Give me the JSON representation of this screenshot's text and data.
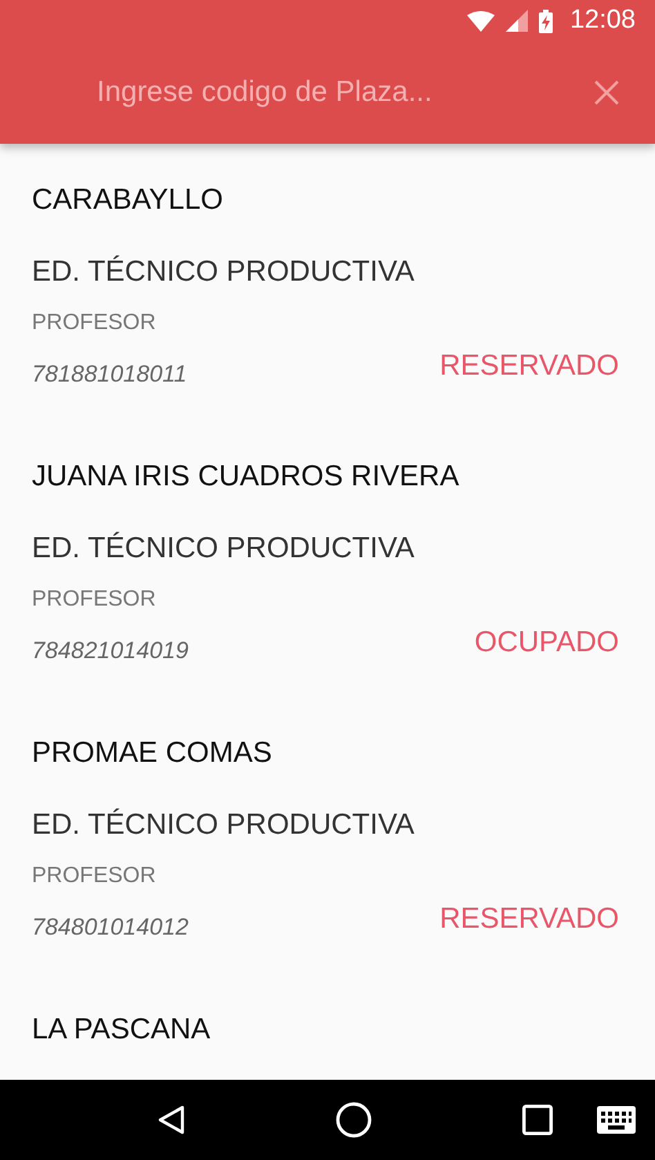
{
  "status_bar": {
    "time": "12:08"
  },
  "search": {
    "placeholder": "Ingrese codigo de Plaza..."
  },
  "items": [
    {
      "name": "CARABAYLLO",
      "type": "ED. TÉCNICO PRODUCTIVA",
      "role": "PROFESOR",
      "code": "781881018011",
      "status": "RESERVADO"
    },
    {
      "name": "JUANA IRIS CUADROS RIVERA",
      "type": "ED. TÉCNICO PRODUCTIVA",
      "role": "PROFESOR",
      "code": "784821014019",
      "status": "OCUPADO"
    },
    {
      "name": "PROMAE COMAS",
      "type": "ED. TÉCNICO PRODUCTIVA",
      "role": "PROFESOR",
      "code": "784801014012",
      "status": "RESERVADO"
    },
    {
      "name": "LA PASCANA"
    }
  ]
}
